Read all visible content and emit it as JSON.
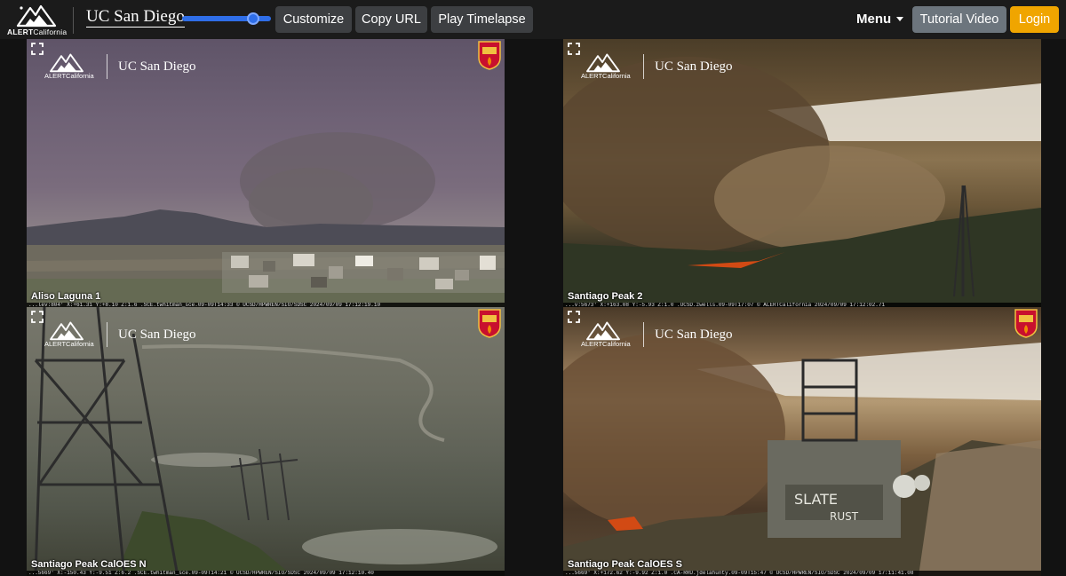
{
  "navbar": {
    "brand": {
      "name_bold": "ALERT",
      "name_rest": "California"
    },
    "partner": "UC San Diego",
    "timelapse_slider": {
      "value": 0.85
    },
    "buttons": {
      "customize": "Customize",
      "copy_url": "Copy URL",
      "play_timelapse": "Play Timelapse",
      "menu": "Menu",
      "tutorial": "Tutorial Video",
      "login": "Login"
    },
    "colors": {
      "slider": "#2f6ee8",
      "tutorial": "#6c757d",
      "login": "#f0a500"
    }
  },
  "cameras": [
    {
      "name": "Aliso Laguna 1",
      "overlay_brand": "ALERTCalifornia",
      "overlay_partner": "UC San Diego",
      "stamp": "...lev:804' X:+61.31 Y:+8.10 Z:1.6 .SCE.twhitman_sce.09-09T14:33 © UCSD/HPWREN/SIO/SDSC 2024/09/09 17:12:19.10"
    },
    {
      "name": "Santiago Peak 2",
      "overlay_brand": "ALERTCalifornia",
      "overlay_partner": "UC San Diego",
      "stamp": "...v:5673' X:+163.08 Y:-5.93 Z:1.0 .UCSD.zwells.09-09T17:07 © ALERTCalifornia 2024/09/09 17:12:02.71"
    },
    {
      "name": "Santiago Peak CalOES N",
      "overlay_brand": "ALERTCalifornia",
      "overlay_partner": "UC San Diego",
      "stamp": "...5669' X:-150.43 Y:-9.51 Z:6.2 .SCE.twhitman_sce.09-09T14:21 © UCSD/HPWREN/SIO/SDSC 2024/09/09 17:12:10.40"
    },
    {
      "name": "Santiago Peak CalOES S",
      "overlay_brand": "ALERTCalifornia",
      "overlay_partner": "UC San Diego",
      "stamp": "...5669' X:+172.62 Y:-9.92 Z:1.0 .CA-RRU.jdelahunty.09-09T15:47 © UCSD/HPWREN/SIO/SDSC 2024/09/09 17:11:41.08"
    }
  ],
  "icons": [
    "alertcalifornia-logo-icon",
    "expand-icon",
    "calfire-badge-icon"
  ]
}
